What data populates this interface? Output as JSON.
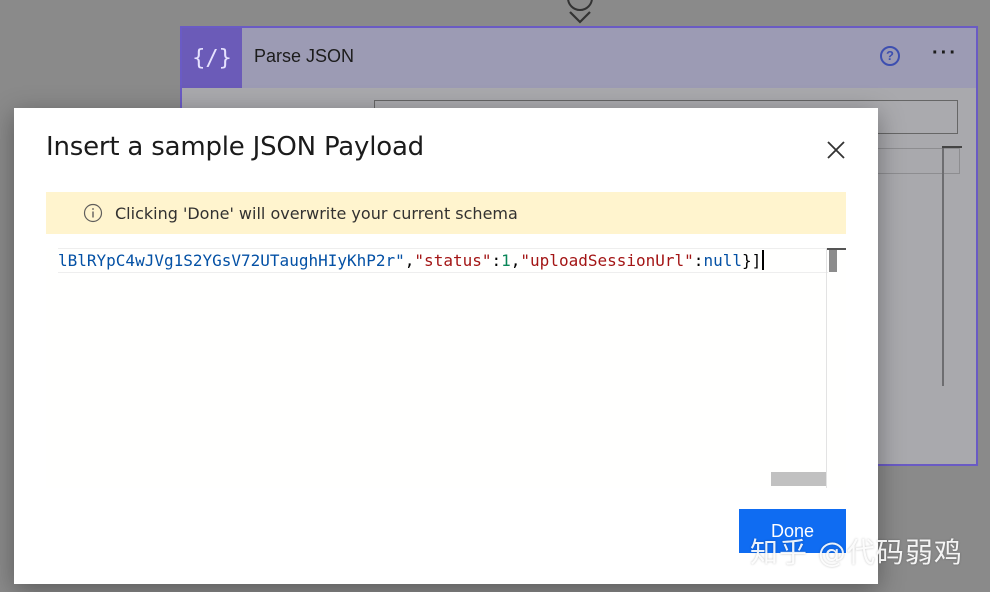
{
  "background_card": {
    "title": "Parse JSON",
    "icon": "json-braces-icon",
    "help_icon": "help-circle-icon",
    "more_icon": "ellipsis-icon",
    "accent_color": "#6b5bb8"
  },
  "modal": {
    "title": "Insert a sample JSON Payload",
    "close_icon": "close-icon",
    "warning": {
      "icon": "info-icon",
      "text": "Clicking 'Done' will overwrite your current schema",
      "background": "#fff4ce"
    },
    "editor": {
      "tokens": [
        {
          "text": "lBlRYpC4wJVg1S2YGsV72UTaughHIyKhP2r\"",
          "type": "val"
        },
        {
          "text": ",",
          "type": "punc"
        },
        {
          "text": "\"status\"",
          "type": "str"
        },
        {
          "text": ":",
          "type": "punc"
        },
        {
          "text": "1",
          "type": "num"
        },
        {
          "text": ",",
          "type": "punc"
        },
        {
          "text": "\"uploadSessionUrl\"",
          "type": "str"
        },
        {
          "text": ":",
          "type": "punc"
        },
        {
          "text": "null",
          "type": "val"
        },
        {
          "text": "}]",
          "type": "punc"
        }
      ]
    },
    "done_label": "Done",
    "done_color": "#0f6cf2"
  },
  "watermark": "知乎 @代码弱鸡"
}
